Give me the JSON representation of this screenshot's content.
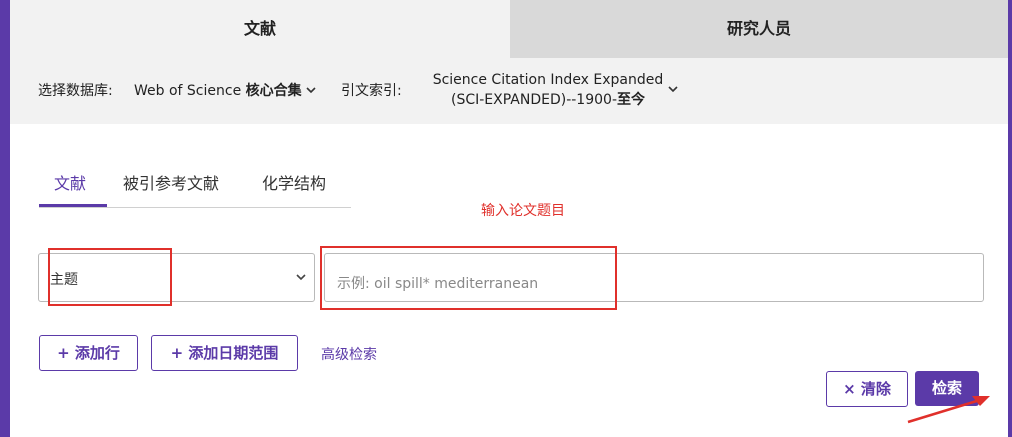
{
  "top_tabs": [
    {
      "label": "文献",
      "active": true
    },
    {
      "label": "研究人员",
      "active": false
    }
  ],
  "db_bar": {
    "db_label": "选择数据库:",
    "db_value_prefix": "Web of Science ",
    "db_value_bold": "核心合集",
    "index_label": "引文索引:",
    "index_line1": "Science Citation Index Expanded",
    "index_line2_prefix": "(SCI-EXPANDED)--1900-",
    "index_line2_bold": "至今"
  },
  "sub_tabs": [
    {
      "label": "文献",
      "active": true
    },
    {
      "label": "被引参考文献",
      "active": false
    },
    {
      "label": "化学结构",
      "active": false
    }
  ],
  "annotation": {
    "text": "输入论文题目",
    "color": "#e0302b"
  },
  "search_row": {
    "field_value": "主题",
    "query_value": "",
    "query_placeholder": "示例: oil spill* mediterranean"
  },
  "actions": {
    "add_row": "+ 添加行",
    "add_date_range": "+ 添加日期范围",
    "advanced_search": "高级检索",
    "clear": "× 清除",
    "search": "检索"
  },
  "colors": {
    "accent": "#5b3aa8",
    "highlight": "#e0302b"
  },
  "icons": {
    "dropdown": "chevron-down-icon",
    "plus": "plus-icon",
    "clear": "close-icon"
  }
}
